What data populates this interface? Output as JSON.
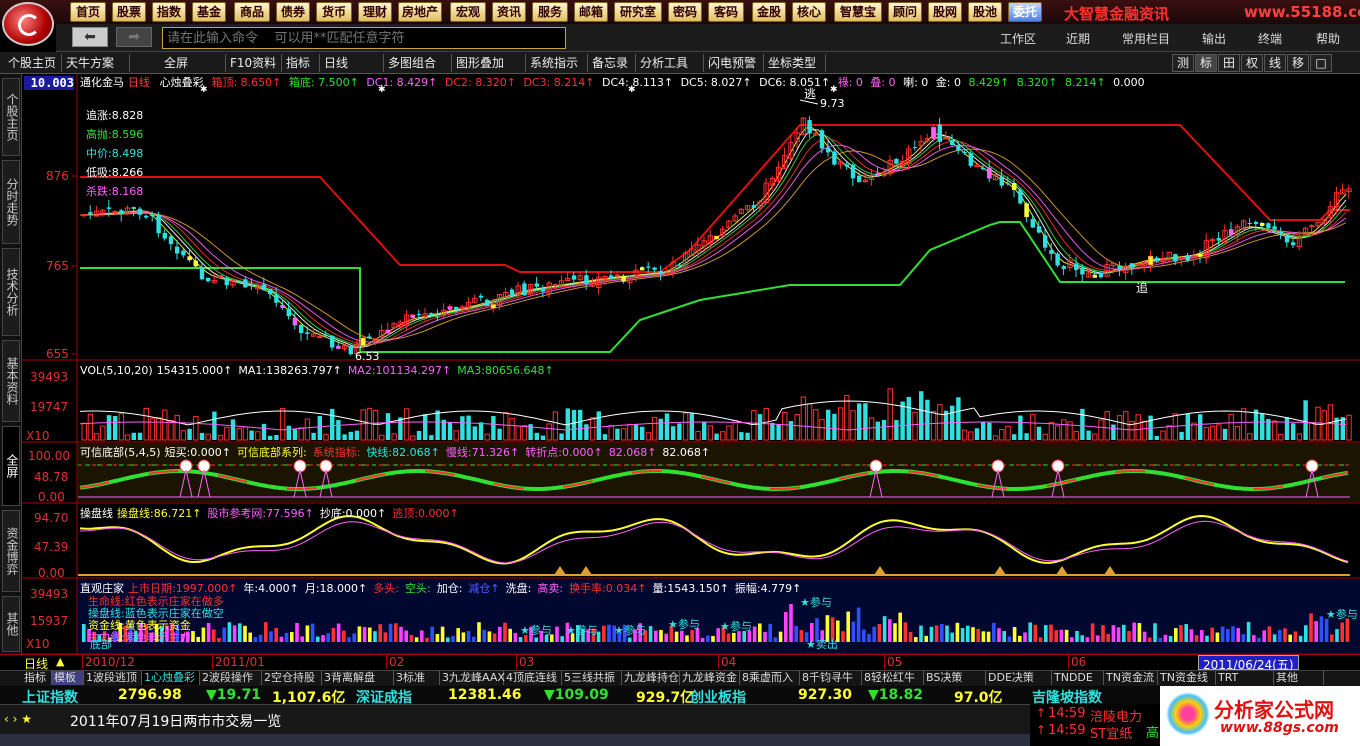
{
  "menu": [
    "首页",
    "股票",
    "指数",
    "基金",
    "商品",
    "债券",
    "货币",
    "理财",
    "房地产",
    "宏观",
    "资讯",
    "服务",
    "邮箱",
    "研究室",
    "密码",
    "客码",
    "金股",
    "核心",
    "智慧宝",
    "顾问",
    "股网",
    "股池",
    "委托"
  ],
  "menu_active_index": 22,
  "brand": "大智慧金融资讯",
  "brand_url": "www.55188.com",
  "command_placeholder": "请在此输入命令    可以用**匹配任意字符",
  "right_menus": [
    "工作区",
    "近期",
    "常用栏目",
    "输出",
    "终端",
    "帮助"
  ],
  "toolbar": [
    "个股主页",
    "天牛方案",
    "全屏",
    "F10资料",
    "指标",
    "日线",
    "多图组合",
    "图形叠加",
    "系统指示",
    "备忘录",
    "分析工具",
    "闪电预警",
    "坐标类型"
  ],
  "toolbar_right": [
    "测",
    "标",
    "田",
    "权",
    "线",
    "移",
    "□"
  ],
  "left_tabs": [
    "个股主页",
    "分时走势",
    "技术分析",
    "基本资料",
    "全屏",
    "资金博弈",
    "其他"
  ],
  "left_tab_active": 4,
  "main": {
    "top_price": "10.003",
    "y_labels": [
      "876",
      "765",
      "655"
    ],
    "title": "通化金马",
    "period": "日线",
    "indicator": "心烛叠彩",
    "params": [
      {
        "k": "箱顶:",
        "v": "8.650",
        "c": "#ff3030"
      },
      {
        "k": "箱底:",
        "v": "7.500",
        "c": "#30e030"
      },
      {
        "k": "DC1:",
        "v": "8.429",
        "c": "#ff60ff"
      },
      {
        "k": "DC2:",
        "v": "8.320",
        "c": "#ff3030"
      },
      {
        "k": "DC3:",
        "v": "8.214",
        "c": "#ff3030"
      },
      {
        "k": "DC4:",
        "v": "8.113",
        "c": "#ffffff"
      },
      {
        "k": "DC5:",
        "v": "8.027",
        "c": "#ffffff"
      },
      {
        "k": "DC6:",
        "v": "8.051",
        "c": "#ffffff"
      },
      {
        "k": "祿:",
        "v": "0",
        "c": "#ff60ff"
      },
      {
        "k": "叠:",
        "v": "0",
        "c": "#ff60ff"
      },
      {
        "k": "喇:",
        "v": "0",
        "c": "#ffffff"
      },
      {
        "k": "金:",
        "v": "0",
        "c": "#ffffff"
      }
    ],
    "extra_vals": [
      "8.429",
      "8.320",
      "8.214",
      "0.000"
    ],
    "levels": [
      {
        "k": "追涨:",
        "v": "8.828",
        "c": "#ffffff"
      },
      {
        "k": "高抛:",
        "v": "8.596",
        "c": "#30e030"
      },
      {
        "k": "中价:",
        "v": "8.498",
        "c": "#30e0e0"
      },
      {
        "k": "低吸:",
        "v": "8.266",
        "c": "#ffffff"
      },
      {
        "k": "杀跌:",
        "v": "8.168",
        "c": "#ff60ff"
      }
    ],
    "high_mark": "9.73",
    "low_mark": "6.53",
    "escape_label": "逃",
    "chase_label": "追"
  },
  "vol": {
    "title": "VOL(5,10,20)",
    "vals": [
      {
        "k": "",
        "v": "154315.000",
        "c": "#ffffff"
      },
      {
        "k": "MA1:",
        "v": "138263.797",
        "c": "#ffffff"
      },
      {
        "k": "MA2:",
        "v": "101134.297",
        "c": "#ff60ff"
      },
      {
        "k": "MA3:",
        "v": "80656.648",
        "c": "#30e030"
      }
    ],
    "y_labels": [
      "39493",
      "19747"
    ],
    "x10": "X10"
  },
  "bottom1": {
    "title": "可信底部(5,4,5)",
    "vals": [
      {
        "k": "短买:",
        "v": "0.000",
        "c": "#ffffff"
      },
      {
        "k": "可信底部系列:",
        "v": "",
        "c": "#ffff30"
      },
      {
        "k": "系统指标:",
        "v": "",
        "c": "#ff3030"
      },
      {
        "k": "快线:",
        "v": "82.068",
        "c": "#30e0e0"
      },
      {
        "k": "慢线:",
        "v": "71.326",
        "c": "#ff60ff"
      },
      {
        "k": "转折点:",
        "v": "0.000",
        "c": "#ff60ff"
      },
      {
        "k": "",
        "v": "82.068",
        "c": "#ff60ff"
      },
      {
        "k": "",
        "v": "82.068",
        "c": "#ffffff"
      }
    ],
    "y_labels": [
      "100.00",
      "48.78",
      "0.00"
    ]
  },
  "bottom2": {
    "title": "操盘线",
    "vals": [
      {
        "k": "操盘线:",
        "v": "86.721",
        "c": "#ffff30"
      },
      {
        "k": "股市参考网:",
        "v": "77.596",
        "c": "#ff60ff"
      },
      {
        "k": "抄底:",
        "v": "0.000",
        "c": "#ffffff"
      },
      {
        "k": "逃顶:",
        "v": "0.000",
        "c": "#ff3030"
      }
    ],
    "y_labels": [
      "94.70",
      "47.39",
      "0.00"
    ]
  },
  "bottom3": {
    "title": "直观庄家",
    "vals": [
      {
        "k": "上市日期:",
        "v": "1997.000",
        "c": "#ff3030"
      },
      {
        "k": "年:",
        "v": "4.000",
        "c": "#ffffff"
      },
      {
        "k": "月:",
        "v": "18.000",
        "c": "#ffffff"
      },
      {
        "k": "多头:",
        "v": "",
        "c": "#ff3030"
      },
      {
        "k": "空头:",
        "v": "",
        "c": "#30e030"
      },
      {
        "k": "加仓:",
        "v": "",
        "c": "#ffffff"
      },
      {
        "k": "",
        "v": "减仓",
        "c": "#5060ff"
      },
      {
        "k": "洗盘:",
        "v": "",
        "c": "#ffffff"
      },
      {
        "k": "高卖:",
        "v": "",
        "c": "#ff60ff"
      },
      {
        "k": "换手率:",
        "v": "0.034",
        "c": "#ff3030"
      },
      {
        "k": "量:",
        "v": "1543.150",
        "c": "#ffffff"
      },
      {
        "k": "振幅:",
        "v": "4.779",
        "c": "#ffffff"
      }
    ],
    "y_labels": [
      "39493",
      "15937"
    ],
    "tags": [
      "参与",
      "参与",
      "参与",
      "参与",
      "参与",
      "参与",
      "参与",
      "卖出"
    ],
    "box_lines": [
      "生命线:红色表示庄家在做多",
      "操盘线:蓝色表示庄家在做空",
      "资金线:黄色表示资金",
      "主力线:紫色表示主力"
    ],
    "x10": "X10",
    "bottom_tag": "底部"
  },
  "date_axis": {
    "period": "日线",
    "labels": [
      "2010/12",
      "2011/01",
      "02",
      "03",
      "04",
      "05",
      "06"
    ],
    "current": "2011/06/24(五)"
  },
  "bottom_tabs": [
    "指标",
    "模板",
    "1波段逃顶",
    "1心烛叠彩",
    "2波段操作",
    "2空仓持股",
    "3背离解盘",
    "3标准",
    "3九龙峰AAX",
    "4顶底连线",
    "5三线共振",
    "九龙峰持仓",
    "九龙峰资金",
    "8乘虚而入",
    "8千钧寻牛",
    "8轻松红牛",
    "BS决策",
    "DDE决策",
    "TNDDE",
    "TN资金流",
    "TN资金线",
    "TRT",
    "其他"
  ],
  "index_bar": [
    {
      "t": "上证指数",
      "c": "#30e0e0"
    },
    {
      "t": "2796.98",
      "c": "#ffff30"
    },
    {
      "t": "▼19.71",
      "c": "#30e030"
    },
    {
      "t": "1,107.6亿",
      "c": "#ffff30"
    },
    {
      "t": "深证成指",
      "c": "#30e0e0"
    },
    {
      "t": "12381.46",
      "c": "#ffff30"
    },
    {
      "t": "▼109.09",
      "c": "#30e030"
    },
    {
      "t": "929.7亿",
      "c": "#ffff30"
    },
    {
      "t": "创业板指",
      "c": "#30e0e0"
    },
    {
      "t": "927.30",
      "c": "#ffff30"
    },
    {
      "t": "▼18.82",
      "c": "#30e030"
    },
    {
      "t": "97.0亿",
      "c": "#ffff30"
    },
    {
      "t": "吉隆坡指数",
      "c": "#30e0e0"
    }
  ],
  "news": "2011年07月19日两市市交易一览",
  "alerts": [
    {
      "time": "14:59",
      "name": "涪陵电力"
    },
    {
      "time": "14:59",
      "name": "ST宜纸"
    }
  ],
  "alert_tail": "高",
  "site_logo": {
    "title": "分析家公式网",
    "url": "www.88gs.com"
  },
  "colors": {
    "up": "#ff3030",
    "down": "#30e0e0",
    "ma_yellow": "#ffff30",
    "box_green": "#30e030",
    "accent": "#c00000"
  }
}
